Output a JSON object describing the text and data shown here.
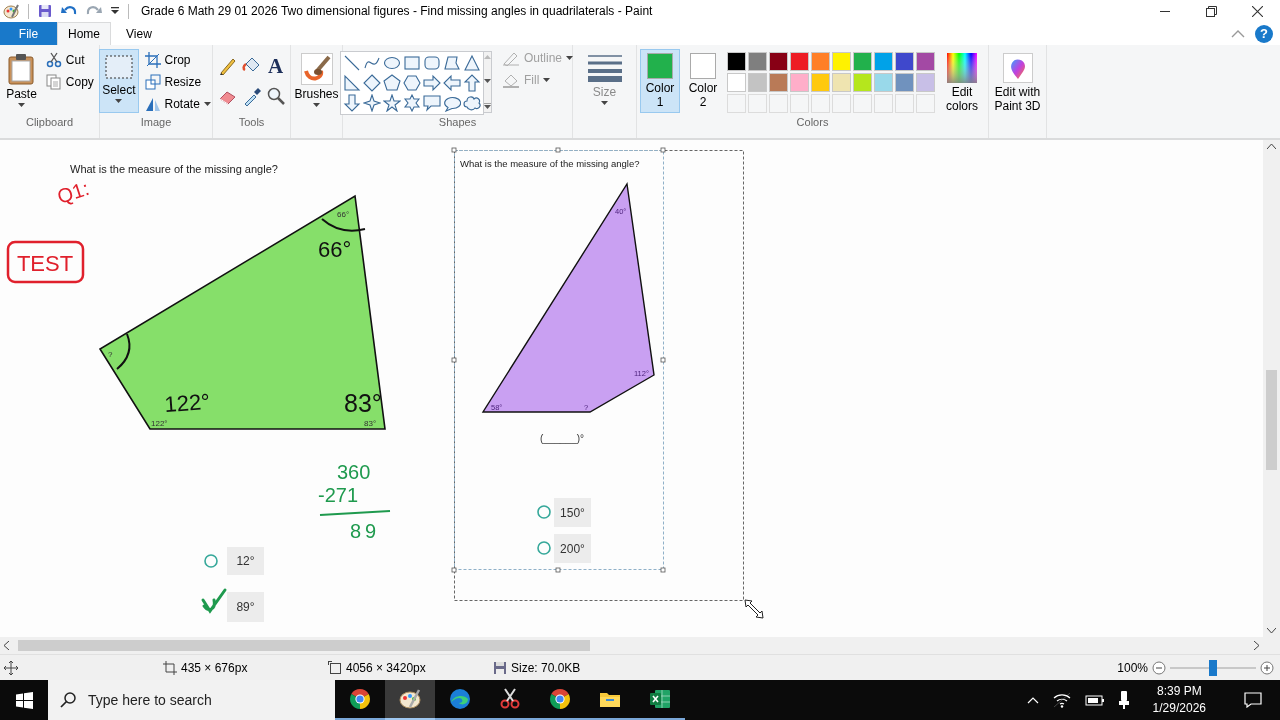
{
  "window": {
    "title": "Grade 6 Math 29 01 2026 Two dimensional figures - Find missing angles in quadrilaterals - Paint"
  },
  "ribbon_tabs": [
    {
      "label": "File",
      "kind": "file",
      "selected": false
    },
    {
      "label": "Home",
      "kind": "tab",
      "selected": true
    },
    {
      "label": "View",
      "kind": "tab",
      "selected": false
    }
  ],
  "ribbon_help": {
    "glyph": "?"
  },
  "clipboard": {
    "title": "Clipboard",
    "paste": "Paste",
    "cut": "Cut",
    "copy": "Copy"
  },
  "image": {
    "title": "Image",
    "select": "Select",
    "select_active": true,
    "crop": "Crop",
    "resize": "Resize",
    "rotate": "Rotate"
  },
  "tools": {
    "title": "Tools",
    "text_glyph": "A"
  },
  "brushes": {
    "label": "Brushes"
  },
  "shapes": {
    "title": "Shapes",
    "outline": "Outline",
    "fill": "Fill",
    "outline_disabled": true,
    "fill_disabled": true
  },
  "size": {
    "label": "Size"
  },
  "colors": {
    "title": "Colors",
    "edit": "Edit colors",
    "slots": [
      {
        "label": "Color 1",
        "color": "#22b14c",
        "selected": true
      },
      {
        "label": "Color 2",
        "color": "#ffffff",
        "selected": false
      }
    ],
    "palette": [
      {
        "color": "#000000"
      },
      {
        "color": "#7f7f7f"
      },
      {
        "color": "#880015"
      },
      {
        "color": "#ed1c24"
      },
      {
        "color": "#ff7f27"
      },
      {
        "color": "#fff200"
      },
      {
        "color": "#22b14c"
      },
      {
        "color": "#00a2e8"
      },
      {
        "color": "#3f48cc"
      },
      {
        "color": "#a349a4"
      },
      {
        "color": "#ffffff"
      },
      {
        "color": "#c3c3c3"
      },
      {
        "color": "#b97a57"
      },
      {
        "color": "#ffaec9"
      },
      {
        "color": "#ffc90e"
      },
      {
        "color": "#efe4b0"
      },
      {
        "color": "#b5e61d"
      },
      {
        "color": "#99d9ea"
      },
      {
        "color": "#7092be"
      },
      {
        "color": "#c8bfe7"
      }
    ]
  },
  "paint3d": {
    "label": "Edit with Paint 3D"
  },
  "canvas": {
    "question_1": {
      "prompt": "What is the measure of the missing angle?",
      "angle_labels": [
        "66°",
        "?",
        "122°",
        "83°"
      ],
      "options": [
        {
          "label": "12°",
          "selected": false
        },
        {
          "label": "89°",
          "selected": true
        }
      ]
    },
    "question_2": {
      "prompt": "What is the measure of the missing angle?",
      "angle_labels": [
        "40°",
        "112°",
        "58°",
        "?"
      ],
      "answer_blank": "(______)°",
      "options": [
        {
          "label": "150°",
          "selected": false
        },
        {
          "label": "200°",
          "selected": false
        }
      ]
    },
    "ink": [
      {
        "text": "Q1:",
        "kind": "plain",
        "color": "#e0202c"
      },
      {
        "text": "TEST",
        "kind": "boxed",
        "color": "#e0202c"
      },
      {
        "text": "66°",
        "kind": "plain",
        "color": "#111111"
      },
      {
        "text": "122°",
        "kind": "plain",
        "color": "#111111"
      },
      {
        "text": "83°",
        "kind": "plain",
        "color": "#111111"
      },
      {
        "text": "360",
        "kind": "plain",
        "color": "#1f9a4e"
      },
      {
        "text": "-271",
        "kind": "plain",
        "color": "#1f9a4e"
      },
      {
        "text": "89",
        "kind": "plain",
        "color": "#1f9a4e"
      }
    ]
  },
  "status_bar": {
    "selection_size": "435 × 676px",
    "image_size": "4056 × 3420px",
    "file_size": "Size: 70.0KB",
    "zoom": "100%",
    "zoom_slider": {
      "level": 0.5
    }
  },
  "taskbar": {
    "search_placeholder": "Type here to search",
    "apps": [
      {
        "kind": "chrome",
        "active": false
      },
      {
        "kind": "paint",
        "active": true
      },
      {
        "kind": "edge",
        "active": false
      },
      {
        "kind": "snip",
        "active": false
      },
      {
        "kind": "chrome",
        "active": false
      },
      {
        "kind": "explorer",
        "active": false
      },
      {
        "kind": "excel",
        "active": false
      }
    ],
    "time": "8:39 PM",
    "date": "1/29/2026"
  }
}
